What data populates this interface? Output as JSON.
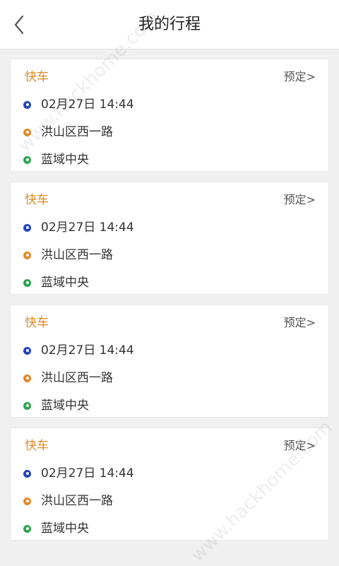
{
  "header": {
    "title": "我的行程",
    "back_icon": "chevron-left-icon"
  },
  "trips": [
    {
      "type": "快车",
      "status": "预定>",
      "time": "02月27日 14:44",
      "from": "洪山区西一路",
      "to": "蓝域中央"
    },
    {
      "type": "快车",
      "status": "预定>",
      "time": "02月27日 14:44",
      "from": "洪山区西一路",
      "to": "蓝域中央"
    },
    {
      "type": "快车",
      "status": "预定>",
      "time": "02月27日 14:44",
      "from": "洪山区西一路",
      "to": "蓝域中央"
    },
    {
      "type": "快车",
      "status": "预定>",
      "time": "02月27日 14:44",
      "from": "洪山区西一路",
      "to": "蓝域中央"
    }
  ],
  "watermark": {
    "top_text": "www.hackhome.com",
    "bottom_text": "www.hackhome.com"
  },
  "colors": {
    "accent_orange": "#e08a2a",
    "time_dot_blue": "#2447b8",
    "destination_dot_green": "#2ea44f",
    "background": "#f0f0f0"
  }
}
